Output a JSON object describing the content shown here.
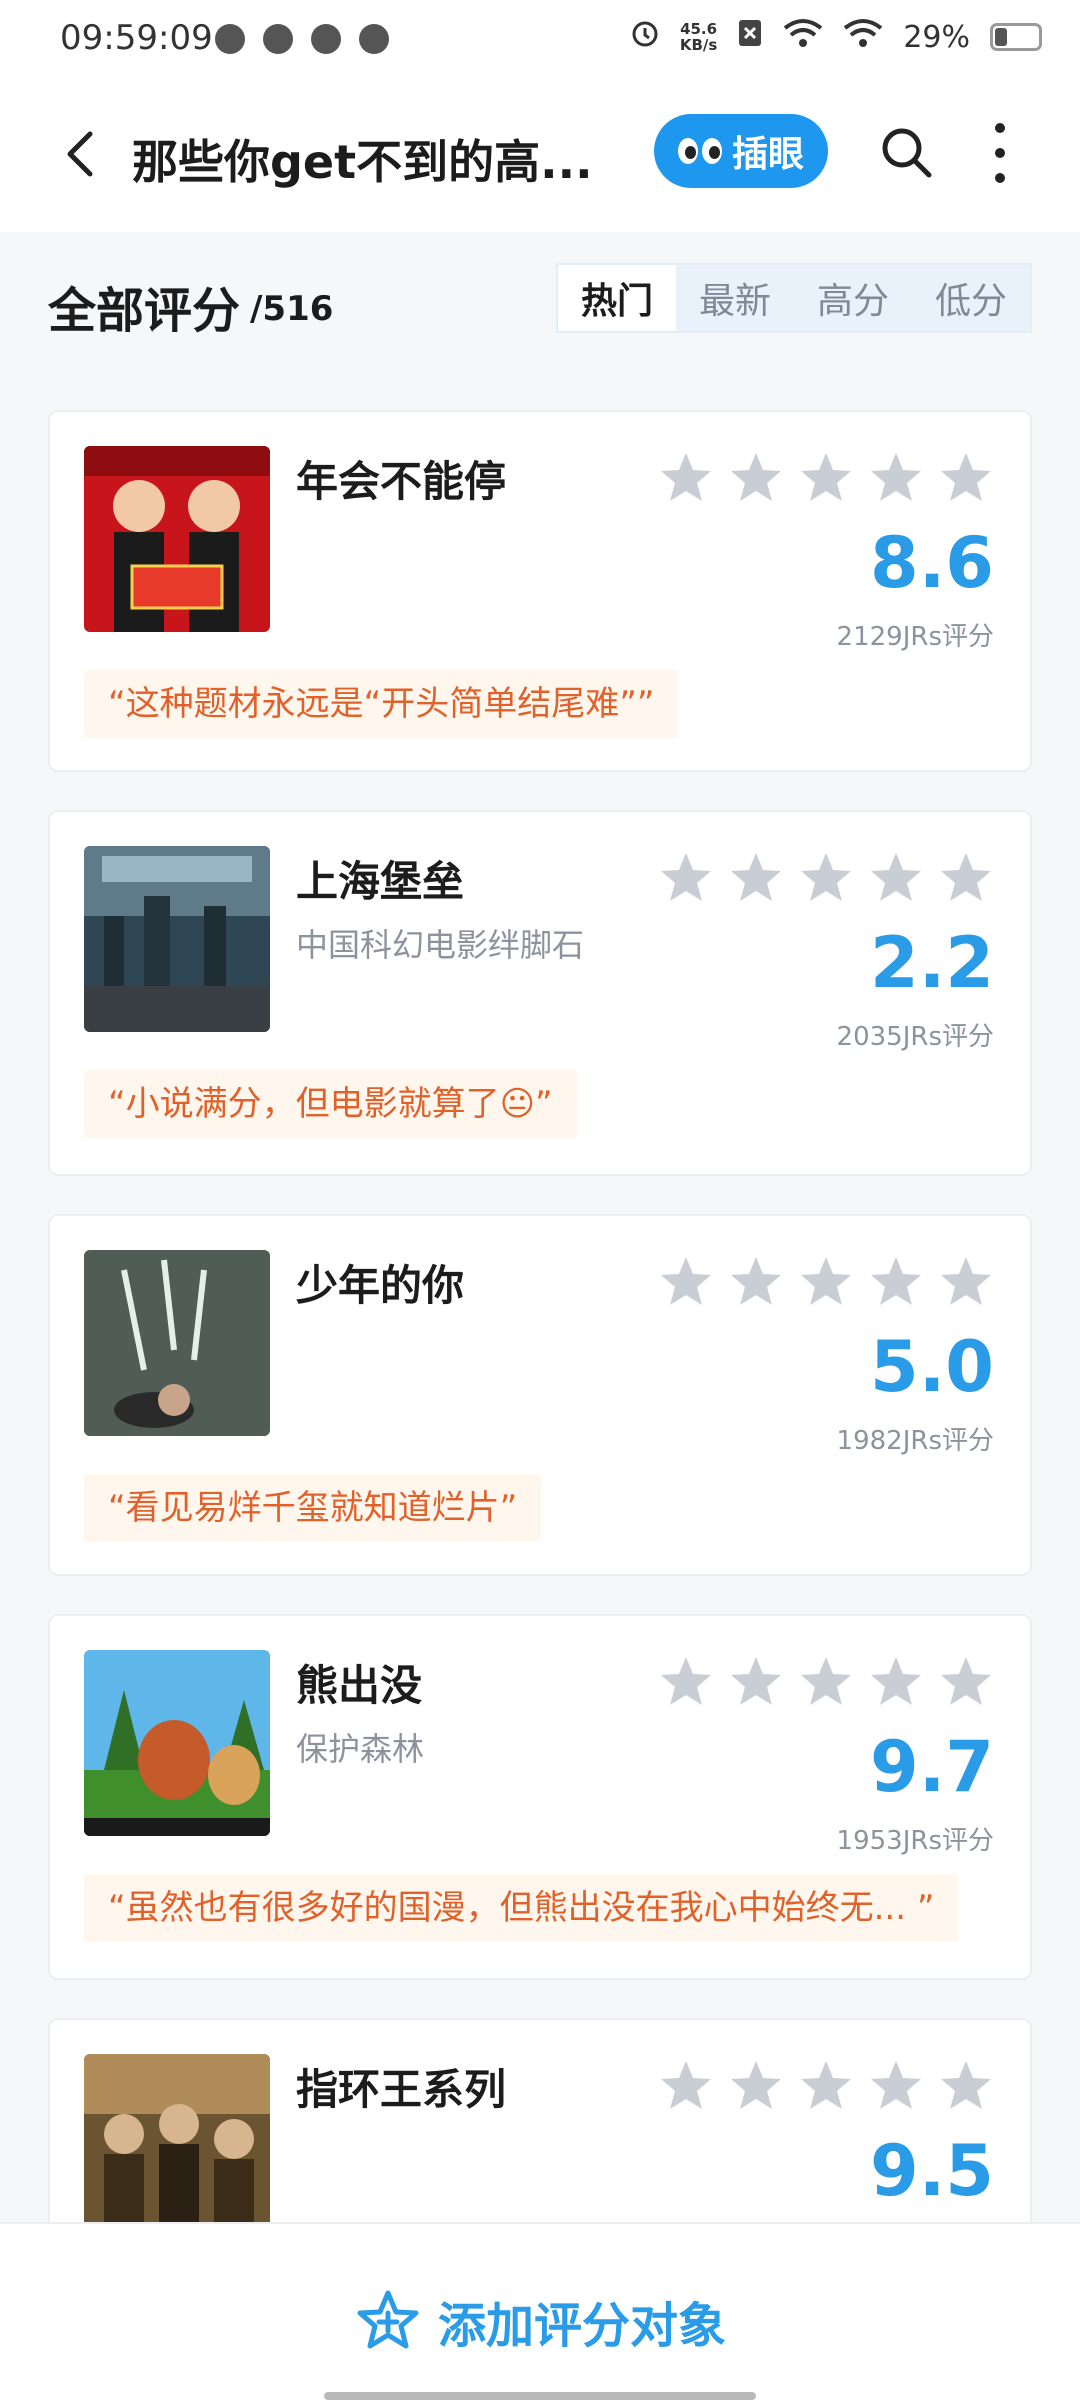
{
  "status_bar": {
    "time": "09:59:09",
    "net_speed_value": "45.6",
    "net_speed_unit": "KB/s",
    "battery": "29%"
  },
  "header": {
    "title": "那些你get不到的高...",
    "peek_label": "插眼"
  },
  "section": {
    "title": "全部评分",
    "count": "/516",
    "sort_tabs": [
      "热门",
      "最新",
      "高分",
      "低分"
    ],
    "active_tab": "热门"
  },
  "items": [
    {
      "title": "年会不能停",
      "subtitle": "",
      "score": "8.6",
      "raters": "2129JRs评分",
      "quote": "“这种题材永远是“开头简单结尾难””"
    },
    {
      "title": "上海堡垒",
      "subtitle": "中国科幻电影绊脚石",
      "score": "2.2",
      "raters": "2035JRs评分",
      "quote": "“小说满分，但电影就算了😐”"
    },
    {
      "title": "少年的你",
      "subtitle": "",
      "score": "5.0",
      "raters": "1982JRs评分",
      "quote": "“看见易烊千玺就知道烂片”"
    },
    {
      "title": "熊出没",
      "subtitle": "保护森林",
      "score": "9.7",
      "raters": "1953JRs评分",
      "quote": "“虽然也有很多好的国漫，但熊出没在我心中始终无... ”"
    },
    {
      "title": "指环王系列",
      "subtitle": "",
      "score": "9.5",
      "raters": "",
      "quote": ""
    }
  ],
  "bottom": {
    "add_label": "添加评分对象"
  },
  "colors": {
    "accent": "#2a9be6",
    "peek_button": "#1e98ee",
    "quote_text": "#e0612a",
    "quote_bg": "#fff7ee",
    "star_empty": "#c9cdd4"
  }
}
